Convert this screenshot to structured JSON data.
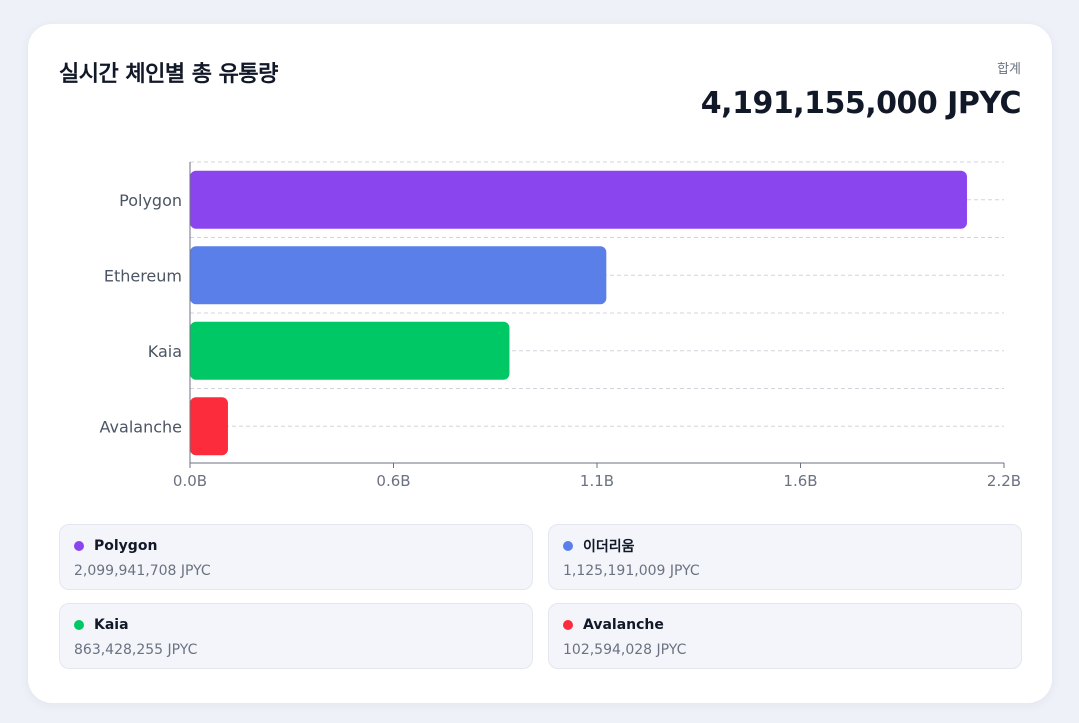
{
  "header": {
    "title": "실시간 체인별 총 유통량",
    "total_label": "합계",
    "total_value": "4,191,155,000 JPYC"
  },
  "chart_data": {
    "type": "bar",
    "orientation": "horizontal",
    "title": "",
    "xlabel": "",
    "ylabel": "",
    "categories": [
      "Polygon",
      "Ethereum",
      "Kaia",
      "Avalanche"
    ],
    "values": [
      2099941708,
      1125191009,
      863428255,
      102594028
    ],
    "colors": [
      "#8b45ee",
      "#5b7fe9",
      "#00c864",
      "#fc2c3c"
    ],
    "xlim": [
      0,
      2200000000
    ],
    "xticks": [
      0,
      550000000,
      1100000000,
      1650000000,
      2200000000
    ],
    "xtick_labels": [
      "0.0B",
      "0.6B",
      "1.1B",
      "1.6B",
      "2.2B"
    ],
    "grid": "horizontal-dashed",
    "legend": "bottom"
  },
  "legend": [
    {
      "name": "Polygon",
      "value": "2,099,941,708 JPYC",
      "color": "#8b45ee"
    },
    {
      "name": "이더리움",
      "value": "1,125,191,009 JPYC",
      "color": "#5b7fe9"
    },
    {
      "name": "Kaia",
      "value": "863,428,255 JPYC",
      "color": "#00c864"
    },
    {
      "name": "Avalanche",
      "value": "102,594,028 JPYC",
      "color": "#fc2c3c"
    }
  ]
}
